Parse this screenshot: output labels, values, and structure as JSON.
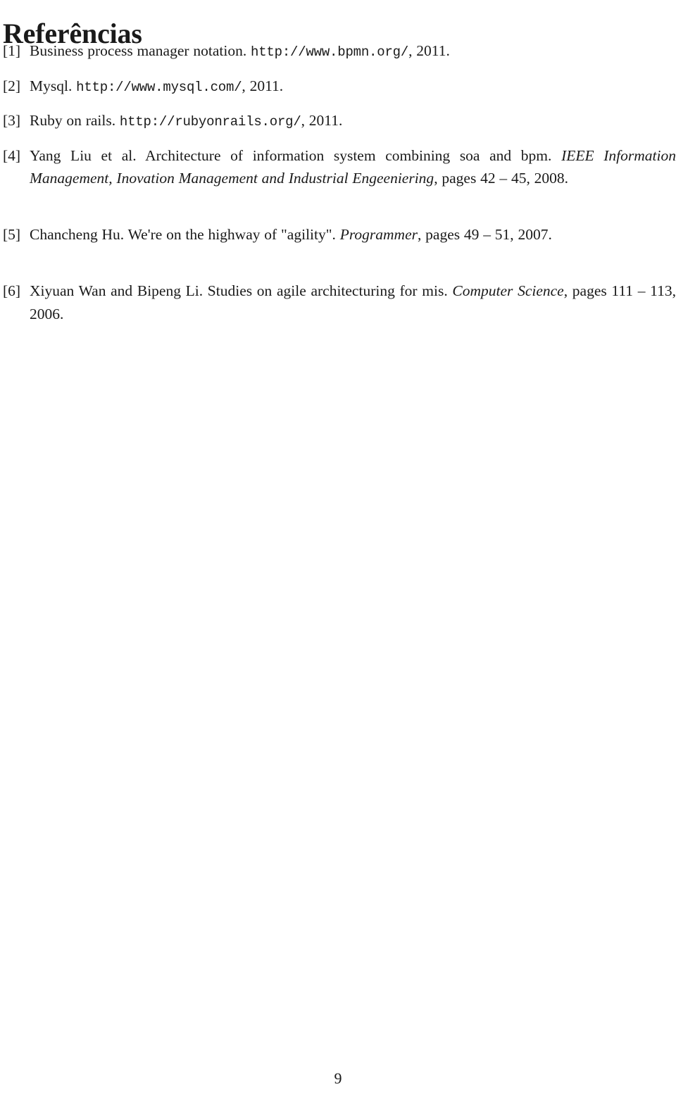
{
  "document": {
    "section_title": "Referências",
    "page_number": "9",
    "text_color": "#1a1a1a",
    "background_color": "#ffffff"
  },
  "references": [
    {
      "label": "[1]",
      "number": "1",
      "plain_text": "Business process manager notation. http://www.bpmn.org/, 2011.",
      "parts": {
        "title": "Business process manager notation.",
        "url": "http://www.bpmn.org/",
        "tail": ", 2011."
      }
    },
    {
      "label": "[2]",
      "number": "2",
      "plain_text": "Mysql. http://www.mysql.com/, 2011.",
      "parts": {
        "title": "Mysql.",
        "url": "http://www.mysql.com/",
        "tail": ", 2011."
      }
    },
    {
      "label": "[3]",
      "number": "3",
      "plain_text": "Ruby on rails. http://rubyonrails.org/, 2011.",
      "parts": {
        "title": "Ruby on rails.",
        "url": "http://rubyonrails.org/",
        "tail": ", 2011."
      }
    },
    {
      "label": "[4]",
      "number": "4",
      "plain_text": "Yang Liu et al. Architecture of information system combining soa and bpm. IEEE Information Management, Inovation Management and Industrial Engeeniering, pages 42 – 45, 2008.",
      "parts": {
        "authors_and_title": "Yang Liu et al. Architecture of information system combining soa and bpm.",
        "venue_italic": "IEEE Information Management, Inovation Management and Industrial Engeeniering",
        "tail": ", pages 42 – 45, 2008."
      }
    },
    {
      "label": "[5]",
      "number": "5",
      "plain_text": "Chancheng Hu. We're on the highway of \"agility\". Programmer, pages 49 – 51, 2007.",
      "parts": {
        "authors_and_title": "Chancheng Hu. We're on the highway of \"agility\".",
        "venue_italic": "Programmer",
        "tail": ", pages 49 – 51, 2007."
      }
    },
    {
      "label": "[6]",
      "number": "6",
      "plain_text": "Xiyuan Wan and Bipeng Li. Studies on agile architecturing for mis. Computer Science, pages 111 – 113, 2006.",
      "parts": {
        "authors_and_title": "Xiyuan Wan and Bipeng Li. Studies on agile architecturing for mis.",
        "venue_italic": "Computer Science",
        "tail": ", pages 111 – 113, 2006."
      }
    }
  ]
}
